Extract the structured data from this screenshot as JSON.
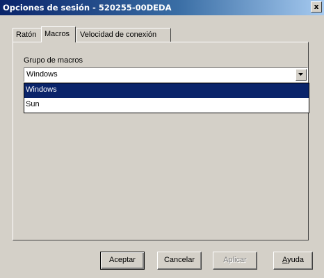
{
  "window": {
    "title": "Opciones de sesión - 520255-00DEDA",
    "close_label": "x"
  },
  "tabs": [
    {
      "label": "Ratón",
      "active": false
    },
    {
      "label": "Macros",
      "active": true
    },
    {
      "label": "Velocidad de conexión",
      "active": false
    }
  ],
  "macros": {
    "group_label": "Grupo de macros",
    "selected_value": "Windows",
    "options": [
      "Windows",
      "Sun"
    ],
    "highlighted_option": "Windows"
  },
  "buttons": {
    "ok": "Aceptar",
    "cancel": "Cancelar",
    "apply": "Aplicar",
    "help_first": "A",
    "help_rest": "yuda"
  },
  "colors": {
    "title_bar_start": "#0a246a",
    "title_bar_end": "#a6caf0",
    "face": "#d4d0c8",
    "selection": "#0a246a"
  }
}
